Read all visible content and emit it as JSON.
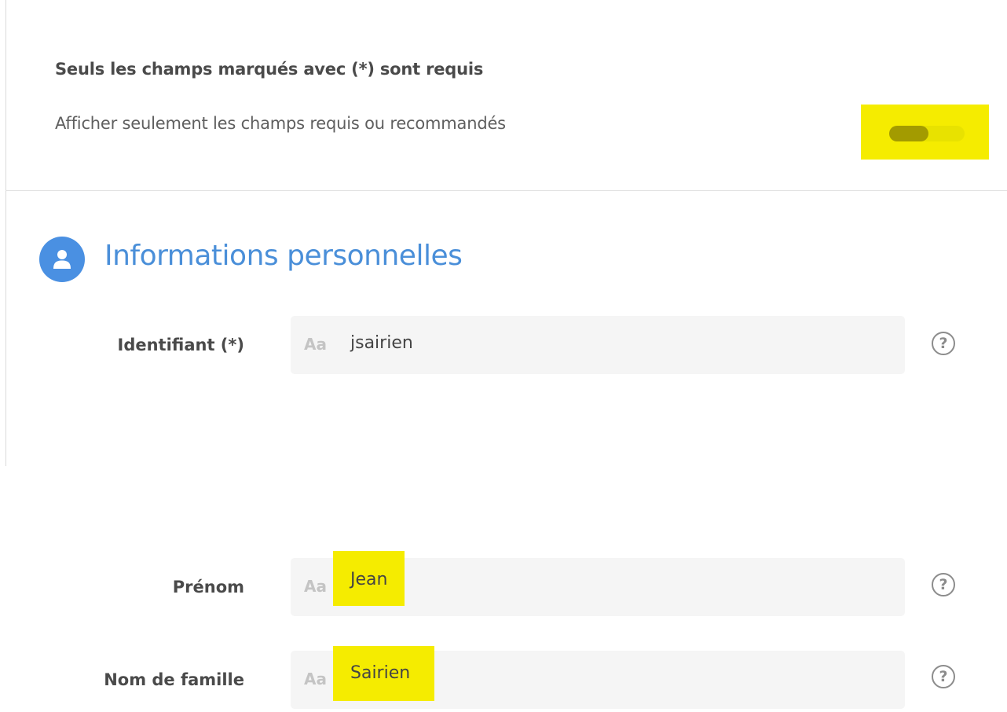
{
  "header": {
    "required_note": "Seuls les champs marqués avec (*) sont requis",
    "filter_label": "Afficher seulement les champs requis ou recommandés",
    "filter_toggle_on": true
  },
  "section": {
    "title": "Informations personnelles",
    "icon": "user-icon"
  },
  "fields": {
    "identifiant": {
      "label": "Identifiant (*)",
      "prefix": "Aa",
      "value": "jsairien",
      "help": "?"
    },
    "prenom": {
      "label": "Prénom",
      "prefix": "Aa",
      "value": "Jean",
      "help": "?"
    },
    "nom": {
      "label": "Nom de famille",
      "prefix": "Aa",
      "value": "Sairien",
      "help": "?"
    }
  },
  "colors": {
    "accent": "#4a90e2",
    "highlight": "#f5ec00",
    "input_background": "#f5f5f5"
  }
}
